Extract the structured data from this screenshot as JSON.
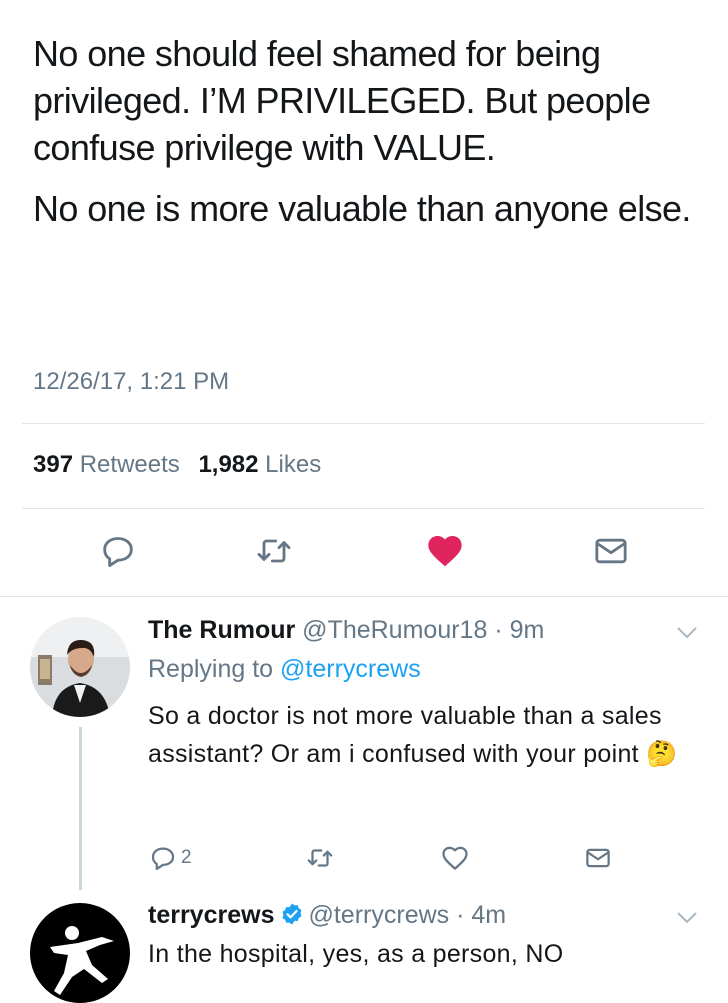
{
  "tweet": {
    "paragraphs": [
      "No one should feel shamed for being privileged. I’M PRIVILEGED. But people confuse privilege with VALUE.",
      "No one is more valuable than anyone else."
    ],
    "timestamp": "12/26/17, 1:21 PM",
    "retweets_count": "397",
    "retweets_label": "Retweets",
    "likes_count": "1,982",
    "likes_label": "Likes",
    "liked": true,
    "colors": {
      "like": "#e0245e",
      "icon": "#657786",
      "link": "#1da1f2"
    }
  },
  "replies": [
    {
      "name": "The Rumour",
      "handle": "@TheRumour18",
      "time": "· 9m",
      "replying_prefix": "Replying to",
      "replying_to": "@terrycrews",
      "text": "So a doctor is not more valuable than a sales assistant? Or am i confused with your point",
      "emoji": "🤔",
      "reply_count": "2"
    },
    {
      "name": "terrycrews",
      "verified": true,
      "handle": "@terrycrews",
      "time": "· 4m",
      "text": "In the hospital, yes, as a person, NO"
    }
  ]
}
